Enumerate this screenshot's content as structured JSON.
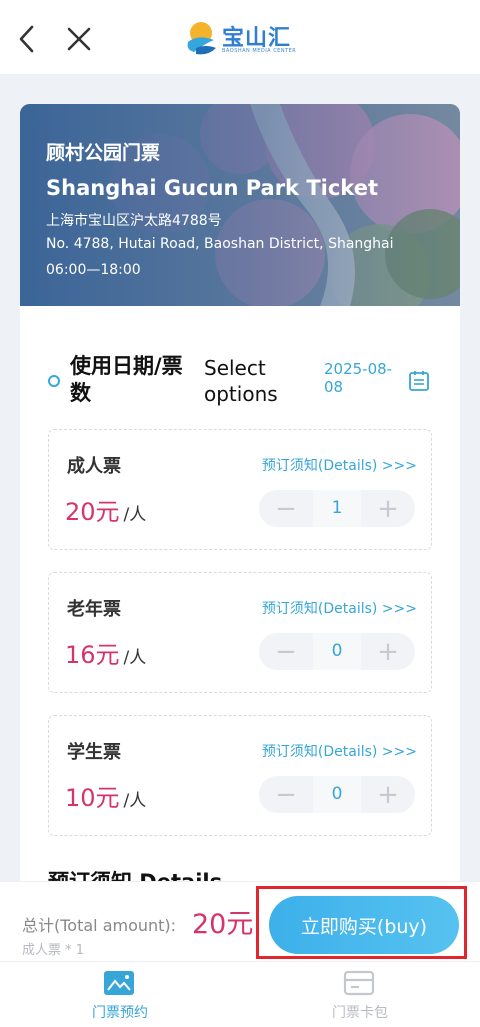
{
  "header": {
    "back_icon": "chevron-left-icon",
    "close_icon": "close-icon",
    "logo_text": "宝山汇",
    "logo_subtitle": "BAOSHAN MEDIA CENTER"
  },
  "banner": {
    "title_cn": "顾村公园门票",
    "title_en": "Shanghai Gucun Park Ticket",
    "address_cn": "上海市宝山区沪太路4788号",
    "address_en": "No. 4788, Hutai Road, Baoshan District, Shanghai",
    "hours": "06:00—18:00"
  },
  "selection": {
    "title": "使用日期/票数",
    "select_options": "Select options",
    "date": "2025-08-08",
    "calendar_icon": "calendar-icon"
  },
  "tickets": [
    {
      "name": "成人票",
      "details": "预订须知(Details) >>>",
      "price": "20元",
      "unit": "/人",
      "quantity": "1"
    },
    {
      "name": "老年票",
      "details": "预订须知(Details) >>>",
      "price": "16元",
      "unit": "/人",
      "quantity": "0"
    },
    {
      "name": "学生票",
      "details": "预订须知(Details) >>>",
      "price": "10元",
      "unit": "/人",
      "quantity": "0"
    }
  ],
  "details_heading": "预订须知 Details",
  "footer": {
    "total_label": "总计(Total amount):",
    "total_value": "20元",
    "total_sub": "成人票 * 1",
    "buy_label": "立即购买(buy)"
  },
  "tabs": [
    {
      "label": "门票预约",
      "icon": "ticket-image-icon",
      "active": true
    },
    {
      "label": "门票卡包",
      "icon": "wallet-icon",
      "active": false
    }
  ],
  "colors": {
    "accent": "#36a6d8",
    "price": "#d6336c",
    "highlight_border": "#e2262e"
  }
}
